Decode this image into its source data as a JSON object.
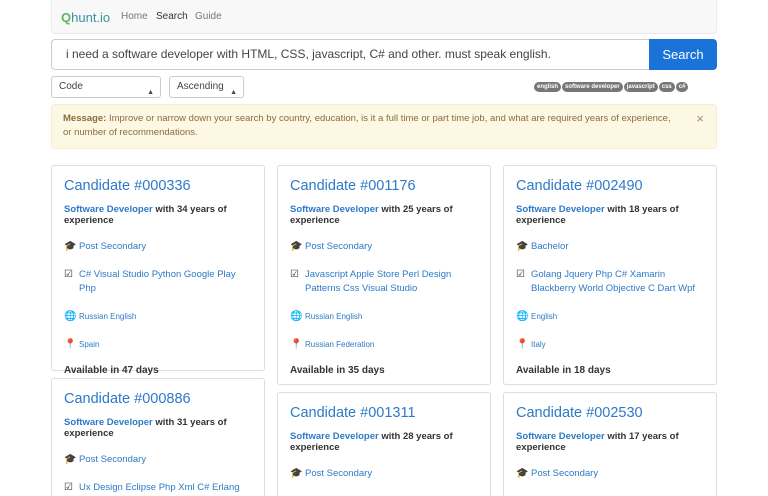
{
  "nav": {
    "brand_q": "Q",
    "brand_rest": "hunt.io",
    "links": [
      "Home",
      "Search",
      "Guide"
    ]
  },
  "search": {
    "query": "i need a software developer with HTML, CSS, javascript, C# and other. must speak english.",
    "button": "Search"
  },
  "filters": {
    "sort_field": "Code",
    "sort_order": "Ascending"
  },
  "tags": [
    "english",
    "software developer",
    "javascript",
    "css",
    "c#"
  ],
  "alert": {
    "label": "Message:",
    "text": "Improve or narrow down your search by country, education, is it a full time or part time job, and what are required years of experience, or number of recommendations.",
    "close": "×"
  },
  "icons": {
    "education": "graduation-cap-icon",
    "skills": "check-square-icon",
    "languages": "globe-icon",
    "location": "map-marker-icon"
  },
  "colors": {
    "link": "#2c7ac8",
    "search_button": "#1a73d9",
    "alert_bg": "#fcf8e3",
    "tag_bg": "#777777"
  },
  "candidates": [
    {
      "title": "Candidate #000336",
      "role": "Software Developer",
      "experience": "with 34 years of experience",
      "education": "Post Secondary",
      "skills": "C# Visual Studio Python Google Play Php",
      "languages": "Russian English",
      "location": "Spain",
      "availability": "Available in 47 days"
    },
    {
      "title": "Candidate #001176",
      "role": "Software Developer",
      "experience": "with 25 years of experience",
      "education": "Post Secondary",
      "skills": "Javascript Apple Store Perl Design Patterns Css Visual Studio",
      "languages": "Russian English",
      "location": "Russian Federation",
      "availability": "Available in 35 days"
    },
    {
      "title": "Candidate #002490",
      "role": "Software Developer",
      "experience": "with 18 years of experience",
      "education": "Bachelor",
      "skills": "Golang Jquery Php C# Xamarin Blackberry World Objective C Dart Wpf",
      "languages": "English",
      "location": "Italy",
      "availability": "Available in 18 days"
    },
    {
      "title": "Candidate #000886",
      "role": "Software Developer",
      "experience": "with 31 years of experience",
      "education": "Post Secondary",
      "skills": "Ux Design Eclipse Php Xml C# Erlang"
    },
    {
      "title": "Candidate #001311",
      "role": "Software Developer",
      "experience": "with 28 years of experience",
      "education": "Post Secondary"
    },
    {
      "title": "Candidate #002530",
      "role": "Software Developer",
      "experience": "with 17 years of experience",
      "education": "Post Secondary"
    }
  ]
}
